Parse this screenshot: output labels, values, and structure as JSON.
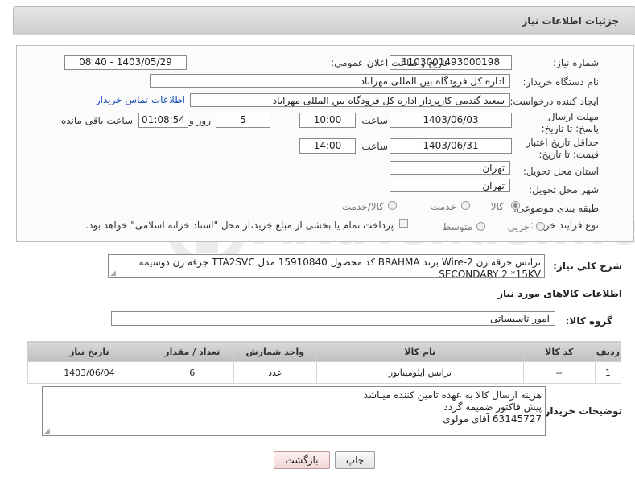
{
  "header": {
    "title": "جزئیات اطلاعات نیاز"
  },
  "form": {
    "need_number_label": "شماره نیاز:",
    "need_number": "1103001493000198",
    "announce_label": "تاریخ و ساعت اعلان عمومی:",
    "announce_value": "1403/05/29 - 08:40",
    "buyer_org_label": "نام دستگاه خریدار:",
    "buyer_org": "اداره کل فرودگاه بین المللی مهراباد",
    "requester_label": "ایجاد کننده درخواست:",
    "requester": "سعید گندمی کارپرداز اداره کل فرودگاه بین المللی مهراباد",
    "contact_link": "اطلاعات تماس خریدار",
    "deadline_label": "مهلت ارسال پاسخ: تا تاریخ:",
    "deadline_date": "1403/06/03",
    "time_label": "ساعت",
    "deadline_time": "10:00",
    "days_value": "5",
    "days_label": "روز و",
    "remaining_time": "01:08:54",
    "remaining_label": "ساعت باقی مانده",
    "validity_label": "حداقل تاریخ اعتبار قیمت: تا تاریخ:",
    "validity_date": "1403/06/31",
    "validity_time": "14:00",
    "province_label": "استان محل تحویل:",
    "province": "تهران",
    "city_label": "شهر محل تحویل:",
    "city": "تهران",
    "category_label": "طبقه بندی موضوعی:",
    "category_options": [
      "کالا",
      "خدمت",
      "کالا/خدمت"
    ],
    "process_label": "نوع فرآیند خرید :",
    "process_options": [
      "جزیی",
      "متوسط"
    ],
    "payment_note": "پرداخت تمام یا بخشی از مبلغ خرید،از محل \"اسناد خزانه اسلامی\" خواهد بود."
  },
  "description": {
    "label": "شرح کلی نیاز:",
    "text": "ترانس جرقه زن Wire-2 برند BRAHMA کد محصول 15910840 مدل TTA2SVC جرقه زن دوسیمه SECONDARY 2 *15KV"
  },
  "goods": {
    "section_title": "اطلاعات کالاهای مورد نیاز",
    "group_label": "گروه کالا:",
    "group_value": "امور تاسیساتی",
    "columns": [
      "ردیف",
      "کد کالا",
      "نام کالا",
      "واحد شمارش",
      "تعداد / مقدار",
      "تاریخ نیاز"
    ],
    "rows": [
      [
        "1",
        "--",
        "ترانس ایلومیناتور",
        "عدد",
        "6",
        "1403/06/04"
      ]
    ]
  },
  "buyer_notes": {
    "label": "توضیحات خریدار:",
    "lines": [
      "هزینه ارسال کالا به عهده تامین کننده میباشد",
      "پیش فاکتور ضمیمه گردد",
      "63145727 آقای مولوی"
    ]
  },
  "buttons": {
    "print": "چاپ",
    "back": "بازگشت"
  },
  "watermark": {
    "text": "AriaTender.neT"
  }
}
